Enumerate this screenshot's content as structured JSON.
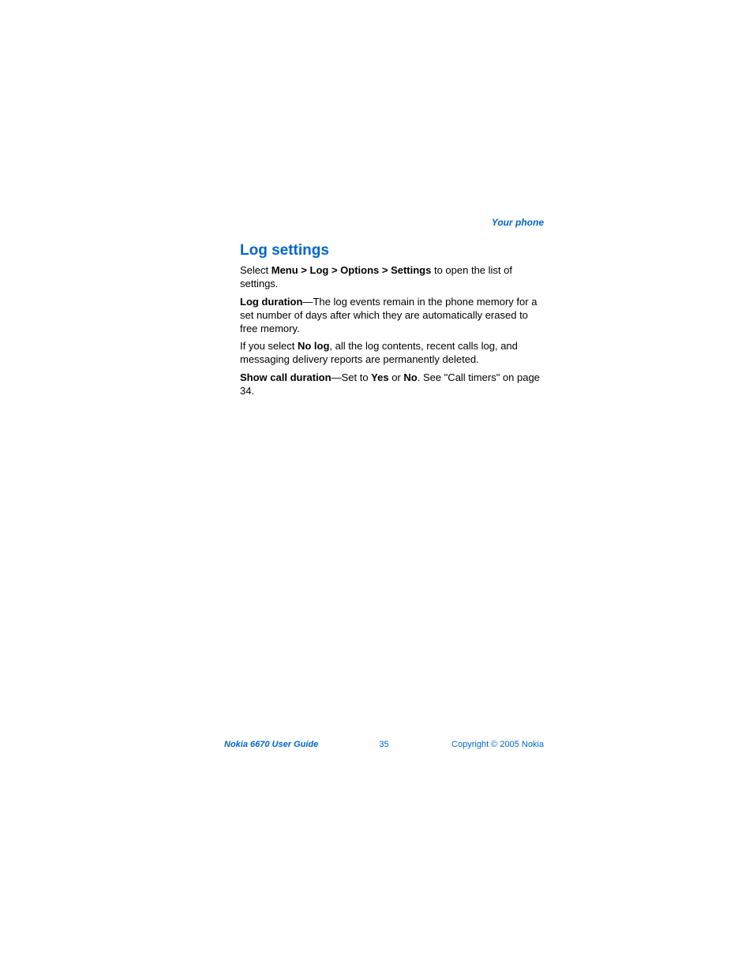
{
  "header": {
    "section": "Your phone"
  },
  "heading": "Log settings",
  "paragraphs": {
    "p1": {
      "prefix": "Select ",
      "bold": "Menu > Log > Options > Settings",
      "suffix": " to open the list of settings."
    },
    "p2": {
      "bold": "Log duration",
      "suffix": "—The log events remain in the phone memory for a set number of days after which they are automatically erased to free memory."
    },
    "p3": {
      "prefix": "If you select ",
      "bold": "No log",
      "suffix": ", all the log contents, recent calls log, and messaging delivery reports are permanently deleted."
    },
    "p4": {
      "bold1": "Show call duration",
      "middle1": "—Set to ",
      "bold2": "Yes",
      "middle2": " or ",
      "bold3": "No",
      "suffix": ". See \"Call timers\" on page 34."
    }
  },
  "footer": {
    "left": "Nokia 6670 User Guide",
    "center": "35",
    "right": "Copyright © 2005 Nokia"
  }
}
